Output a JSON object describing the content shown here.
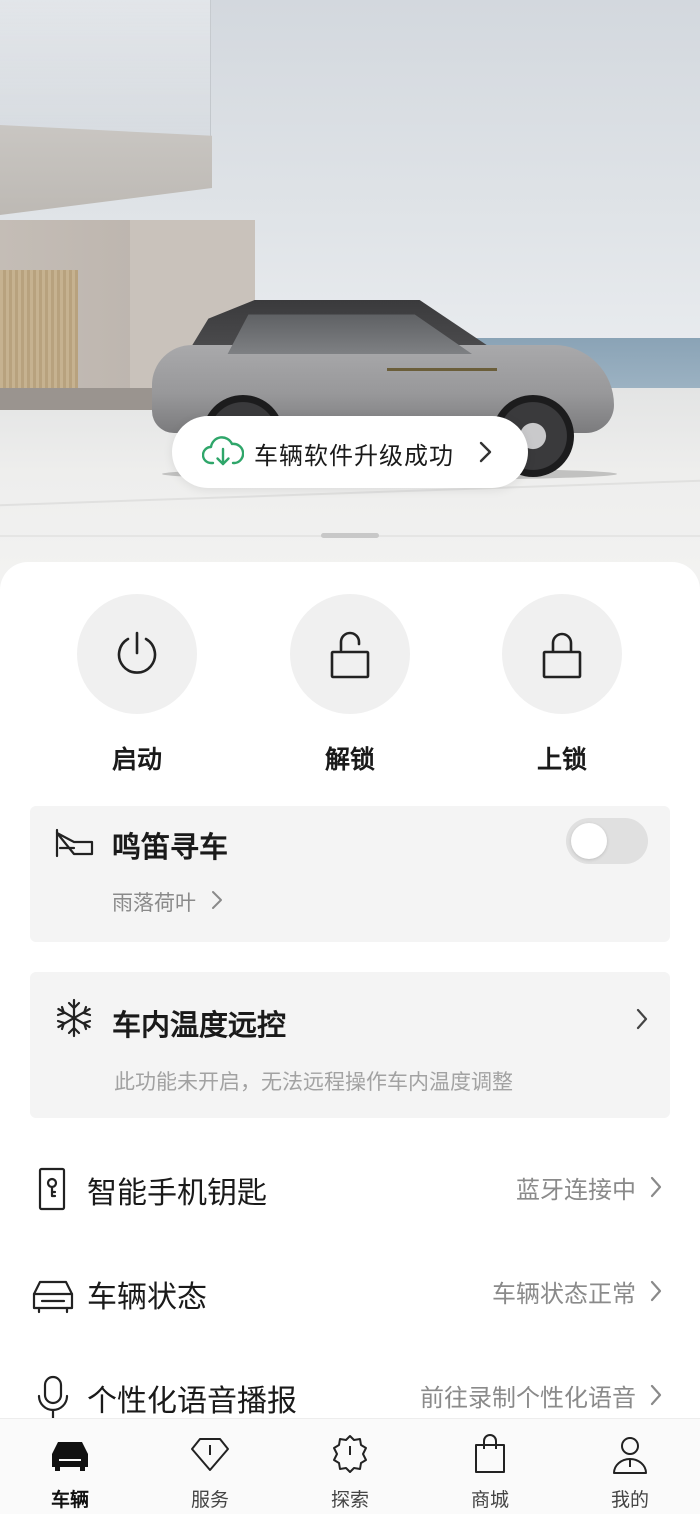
{
  "hero": {
    "banner_text": "车辆软件升级成功",
    "banner_icon": "cloud-download-icon"
  },
  "quick_actions": [
    {
      "label": "启动",
      "icon": "power-icon"
    },
    {
      "label": "解锁",
      "icon": "unlock-icon"
    },
    {
      "label": "上锁",
      "icon": "lock-icon"
    }
  ],
  "horn": {
    "title": "鸣笛寻车",
    "subtitle": "雨落荷叶",
    "icon": "horn-icon",
    "toggle_on": false
  },
  "climate": {
    "title": "车内温度远控",
    "note": "此功能未开启，无法远程操作车内温度调整",
    "icon": "snowflake-icon"
  },
  "list": [
    {
      "label": "智能手机钥匙",
      "value": "蓝牙连接中",
      "icon": "phone-key-icon"
    },
    {
      "label": "车辆状态",
      "value": "车辆状态正常",
      "icon": "car-status-icon"
    },
    {
      "label": "个性化语音播报",
      "value": "前往录制个性化语音",
      "icon": "microphone-icon"
    }
  ],
  "nav": [
    {
      "label": "车辆",
      "icon": "car-icon",
      "active": true
    },
    {
      "label": "服务",
      "icon": "diamond-icon",
      "active": false
    },
    {
      "label": "探索",
      "icon": "explore-badge-icon",
      "active": false
    },
    {
      "label": "商城",
      "icon": "shopping-bag-icon",
      "active": false
    },
    {
      "label": "我的",
      "icon": "profile-icon",
      "active": false
    }
  ],
  "colors": {
    "accent_green": "#2fa66a",
    "card_bg": "#f4f4f4",
    "secondary_text": "#8a8a8a"
  }
}
